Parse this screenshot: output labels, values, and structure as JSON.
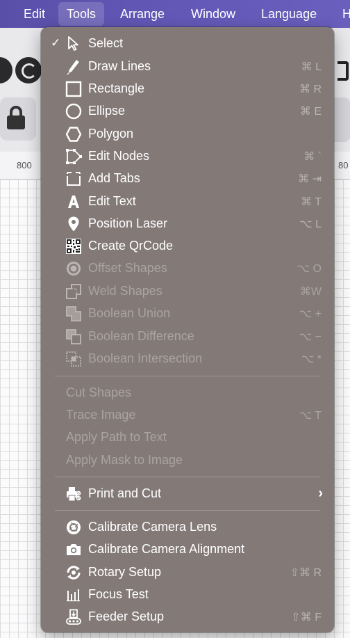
{
  "menubar": {
    "items": [
      "Edit",
      "Tools",
      "Arrange",
      "Window",
      "Language",
      "H"
    ]
  },
  "ruler": {
    "left_label": "800",
    "right_label": "80"
  },
  "menu": {
    "groups": [
      [
        {
          "label": "Select",
          "icon": "cursor-arrow-icon",
          "shortcut": "",
          "checked": true,
          "disabled": false
        },
        {
          "label": "Draw Lines",
          "icon": "pen-icon",
          "shortcut": "⌘ L",
          "disabled": false
        },
        {
          "label": "Rectangle",
          "icon": "rectangle-icon",
          "shortcut": "⌘ R",
          "disabled": false
        },
        {
          "label": "Ellipse",
          "icon": "ellipse-icon",
          "shortcut": "⌘ E",
          "disabled": false
        },
        {
          "label": "Polygon",
          "icon": "hexagon-icon",
          "shortcut": "",
          "disabled": false
        },
        {
          "label": "Edit Nodes",
          "icon": "edit-nodes-icon",
          "shortcut": "⌘ `",
          "disabled": false
        },
        {
          "label": "Add Tabs",
          "icon": "add-tabs-icon",
          "shortcut": "⌘ ⇥",
          "disabled": false
        },
        {
          "label": "Edit Text",
          "icon": "text-a-icon",
          "shortcut": "⌘ T",
          "disabled": false
        },
        {
          "label": "Position Laser",
          "icon": "location-pin-icon",
          "shortcut": "⌥ L",
          "disabled": false
        },
        {
          "label": "Create QrCode",
          "icon": "qr-code-icon",
          "shortcut": "",
          "disabled": false
        },
        {
          "label": "Offset Shapes",
          "icon": "offset-shapes-icon",
          "shortcut": "⌥ O",
          "disabled": true
        },
        {
          "label": "Weld Shapes",
          "icon": "weld-shapes-icon",
          "shortcut": "⌘W",
          "disabled": true
        },
        {
          "label": "Boolean Union",
          "icon": "boolean-union-icon",
          "shortcut": "⌥ +",
          "disabled": true
        },
        {
          "label": "Boolean Difference",
          "icon": "boolean-difference-icon",
          "shortcut": "⌥ −",
          "disabled": true
        },
        {
          "label": "Boolean Intersection",
          "icon": "boolean-intersection-icon",
          "shortcut": "⌥ *",
          "disabled": true
        }
      ],
      [
        {
          "label": "Cut Shapes",
          "shortcut": "",
          "disabled": true
        },
        {
          "label": "Trace Image",
          "shortcut": "⌥ T",
          "disabled": true
        },
        {
          "label": "Apply Path to Text",
          "shortcut": "",
          "disabled": true
        },
        {
          "label": "Apply Mask to Image",
          "shortcut": "",
          "disabled": true
        }
      ],
      [
        {
          "label": "Print and Cut",
          "icon": "print-cut-icon",
          "shortcut": "",
          "submenu": true,
          "disabled": false
        }
      ],
      [
        {
          "label": "Calibrate Camera Lens",
          "icon": "camera-lens-icon",
          "shortcut": "",
          "disabled": false
        },
        {
          "label": "Calibrate Camera Alignment",
          "icon": "camera-icon",
          "shortcut": "",
          "disabled": false
        },
        {
          "label": "Rotary Setup",
          "icon": "rotary-icon",
          "shortcut": "⇧⌘ R",
          "disabled": false
        },
        {
          "label": "Focus Test",
          "icon": "focus-bars-icon",
          "shortcut": "",
          "disabled": false
        },
        {
          "label": "Feeder Setup",
          "icon": "feeder-icon",
          "shortcut": "⇧⌘ F",
          "disabled": false
        }
      ]
    ]
  }
}
